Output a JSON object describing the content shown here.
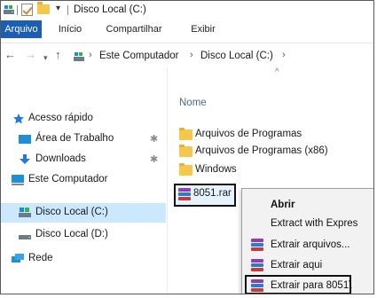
{
  "window": {
    "title": "Disco Local (C:)"
  },
  "ribbon": {
    "tabs": [
      {
        "label": "Arquivo",
        "active": true
      },
      {
        "label": "Início",
        "active": false
      },
      {
        "label": "Compartilhar",
        "active": false
      },
      {
        "label": "Exibir",
        "active": false
      }
    ]
  },
  "navigation": {
    "back_icon": "arrow-left",
    "forward_icon": "arrow-right",
    "history_icon": "chevron-down",
    "up_icon": "arrow-up",
    "breadcrumb": [
      "Este Computador",
      "Disco Local (C:)"
    ],
    "separator": "›"
  },
  "sidebar": {
    "items": [
      {
        "label": "Acesso rápido",
        "icon": "star-icon",
        "pinned": false,
        "selected": false
      },
      {
        "label": "Área de Trabalho",
        "icon": "desktop-icon",
        "pinned": true,
        "selected": false
      },
      {
        "label": "Downloads",
        "icon": "download-icon",
        "pinned": true,
        "selected": false
      },
      {
        "label": "Este Computador",
        "icon": "computer-icon",
        "pinned": false,
        "selected": false
      },
      {
        "label": "Disco Local (C:)",
        "icon": "drive-icon",
        "pinned": false,
        "selected": true
      },
      {
        "label": "Disco Local (D:)",
        "icon": "drive-icon",
        "pinned": false,
        "selected": false
      },
      {
        "label": "Rede",
        "icon": "network-icon",
        "pinned": false,
        "selected": false
      }
    ],
    "pin_glyph": "📌"
  },
  "content": {
    "column_header": "Nome",
    "files": [
      {
        "name": "Arquivos de Programas",
        "type": "folder"
      },
      {
        "name": "Arquivos de Programas (x86)",
        "type": "folder"
      },
      {
        "name": "Windows",
        "type": "folder"
      },
      {
        "name": "8051.rar",
        "type": "rar"
      }
    ]
  },
  "context_menu": {
    "items": [
      {
        "label": "Abrir",
        "bold": true,
        "icon": null
      },
      {
        "label": "Extract with Expres",
        "bold": false,
        "icon": null
      },
      {
        "label": "Extrair arquivos...",
        "bold": false,
        "icon": "winrar-icon"
      },
      {
        "label": "Extrair aqui",
        "bold": false,
        "icon": "winrar-icon"
      },
      {
        "label": "Extrair para 8051\\",
        "bold": false,
        "icon": "winrar-icon"
      }
    ]
  },
  "colors": {
    "accent": "#1a5fb4",
    "selection": "#cce8ff",
    "folder": "#f4c84c",
    "menu_background": "#f2f2f2"
  }
}
